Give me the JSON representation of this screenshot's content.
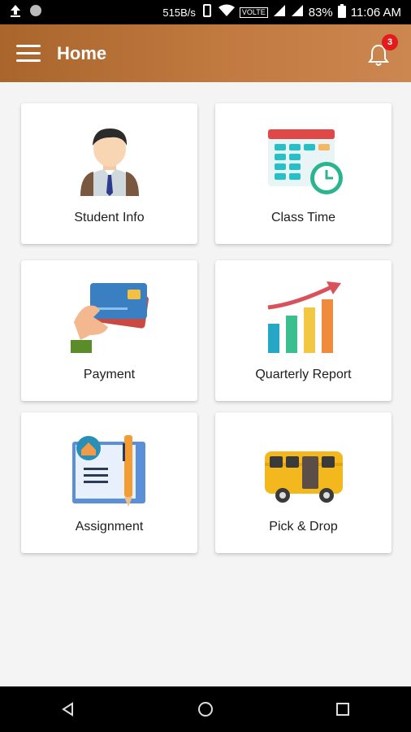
{
  "status_bar": {
    "net_speed": "515B/s",
    "volte": "VOLTE",
    "battery": "83%",
    "time": "11:06 AM",
    "icons": [
      "upload-icon",
      "notification-dot-icon",
      "vibrate-icon",
      "wifi-icon",
      "signal-icon",
      "battery-icon"
    ]
  },
  "app_bar": {
    "title": "Home",
    "notification_count": "3",
    "colors": {
      "gradient_start": "#a9652c",
      "gradient_end": "#cc8650",
      "badge": "#e21b1b"
    }
  },
  "tiles": [
    {
      "label": "Student Info",
      "icon": "student-icon"
    },
    {
      "label": "Class Time",
      "icon": "calendar-clock-icon"
    },
    {
      "label": "Payment",
      "icon": "credit-card-icon"
    },
    {
      "label": "Quarterly Report",
      "icon": "bar-growth-icon"
    },
    {
      "label": "Assignment",
      "icon": "notebook-pen-icon"
    },
    {
      "label": "Pick & Drop",
      "icon": "bus-icon"
    }
  ],
  "nav_bar": {
    "buttons": [
      "back-icon",
      "home-icon",
      "recents-icon"
    ]
  }
}
